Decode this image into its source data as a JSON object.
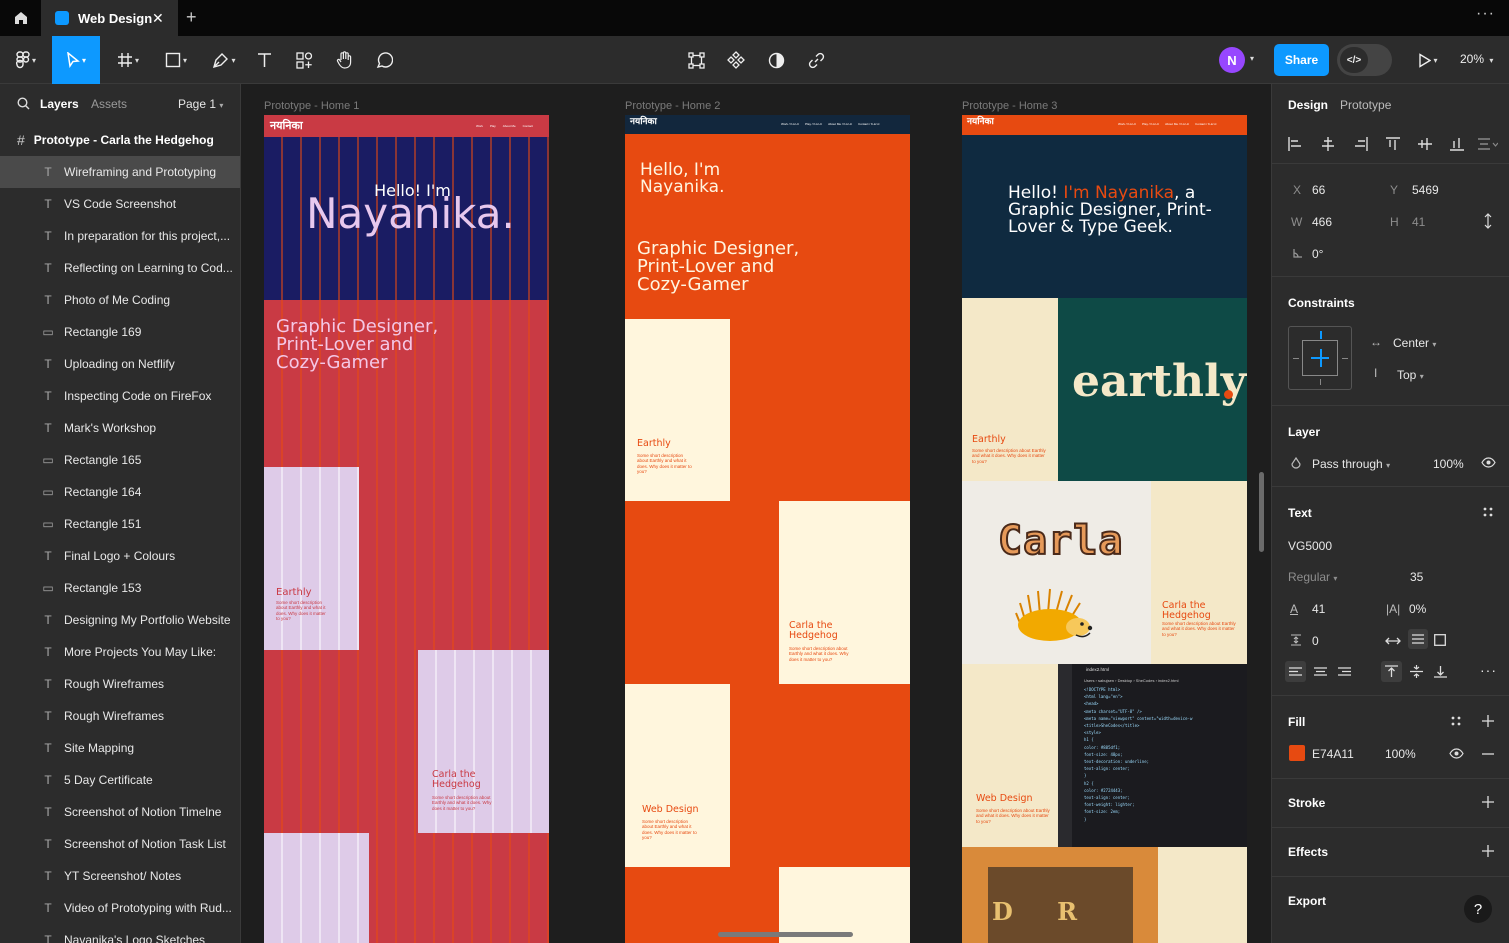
{
  "colors": {
    "accent": "#0d99ff",
    "fill": "#E74A11",
    "avatar": "#9747ff"
  },
  "titlebar": {
    "file_title": "Web Design",
    "close_glyph": "✕",
    "new_tab_glyph": "+",
    "more_glyph": "···",
    "home_icon": "home-icon"
  },
  "toolbar": {
    "avatar_initial": "N",
    "share_label": "Share",
    "dev_mode_glyph": "</>",
    "zoom": "20%"
  },
  "left": {
    "tab_layers": "Layers",
    "tab_assets": "Assets",
    "page": "Page 1",
    "root": "Prototype - Carla the Hedgehog",
    "layers": [
      {
        "name": "Wireframing and Prototyping",
        "type": "text"
      },
      {
        "name": "VS Code Screenshot",
        "type": "text"
      },
      {
        "name": "In preparation for this project,...",
        "type": "text"
      },
      {
        "name": "Reflecting on Learning to Cod...",
        "type": "text"
      },
      {
        "name": "Photo of Me Coding",
        "type": "text"
      },
      {
        "name": "Rectangle 169",
        "type": "rect"
      },
      {
        "name": "Uploading on Netflify",
        "type": "text"
      },
      {
        "name": "Inspecting Code on FireFox",
        "type": "text"
      },
      {
        "name": "Mark's Workshop",
        "type": "text"
      },
      {
        "name": "Rectangle 165",
        "type": "rect"
      },
      {
        "name": "Rectangle 164",
        "type": "rect"
      },
      {
        "name": "Rectangle 151",
        "type": "rect"
      },
      {
        "name": "Final Logo + Colours",
        "type": "text"
      },
      {
        "name": "Rectangle 153",
        "type": "rect"
      },
      {
        "name": "Designing My Portfolio Website",
        "type": "text"
      },
      {
        "name": "More Projects You May Like:",
        "type": "text"
      },
      {
        "name": "Rough Wireframes",
        "type": "text"
      },
      {
        "name": "Rough Wireframes",
        "type": "text"
      },
      {
        "name": "Site Mapping",
        "type": "text"
      },
      {
        "name": "5 Day Certificate",
        "type": "text"
      },
      {
        "name": "Screenshot of Notion Timelne",
        "type": "text"
      },
      {
        "name": "Screenshot of Notion Task List",
        "type": "text"
      },
      {
        "name": "YT Screenshot/ Notes",
        "type": "text"
      },
      {
        "name": "Video of Prototyping with Rud...",
        "type": "text"
      },
      {
        "name": "Navanika's Logo Sketches",
        "type": "text"
      }
    ]
  },
  "canvas": {
    "frame1": {
      "label": "Prototype - Home 1",
      "logo": "नयनिका",
      "nav": [
        "Work",
        "Play",
        "About Me",
        "Contact"
      ],
      "hello": "Hello! I'm",
      "name": "Nayanika.",
      "tagline": "Graphic Designer, Print-Lover and Cozy-Gamer",
      "card1_title": "Earthly",
      "card1_desc": "Some short description about Earthly and what it does. Why does it matter to you?",
      "card2_title": "Carla the Hedgehog",
      "card2_desc": "Some short description about Earthly and what it does. Why does it matter to you?"
    },
    "frame2": {
      "label": "Prototype - Home 2",
      "logo": "नयनिका",
      "nav": [
        "Work / K-k/-/c",
        "Play / K-k/-/c",
        "About Me / K-k/-/c",
        "Contact / K-k/-/c"
      ],
      "hello": "Hello, I'm Nayanika.",
      "tagline": "Graphic Designer, Print-Lover and Cozy-Gamer",
      "card1_title": "Earthly",
      "card1_desc": "Some short description about Earthly and what it does. Why does it matter to you?",
      "card2_title": "Carla the Hedgehog",
      "card2_desc": "Some short description about Earthly and what it does. Why does it matter to you?",
      "card3_title": "Web Design",
      "card3_desc": "Some short description about Earthly and what it does. Why does it matter to you?"
    },
    "frame3": {
      "label": "Prototype - Home 3",
      "logo": "नयनिका",
      "nav": [
        "Work / K-k/-/c",
        "Play / K-k/-/c",
        "About Me / K-k/-/c",
        "Contact / K-k/-/c"
      ],
      "hello_pre": "Hello! ",
      "hello_name": "I'm Nayanika",
      "hello_post": ", a Graphic Designer, Print-Lover & Type Geek.",
      "earthly_logo": "earthly",
      "card1_title": "Earthly",
      "card1_desc": "Some short description about Earthly and what it does. Why does it matter to you?",
      "carla_logo": "Carla",
      "card2_title": "Carla the Hedgehog",
      "card2_desc": "Some short description about Earthly and what it does. Why does it matter to you?",
      "card3_title": "Web Design",
      "card3_desc": "Some short description about Earthly and what it does. Why does it matter to you?",
      "code_tab": "index2.html",
      "code_path": "Users › sabujsen › Desktop › SheCodes › index2.html",
      "code_lines": [
        "<!DOCTYPE html>",
        "<html lang=\"en\">",
        "<head>",
        "<meta charset=\"UTF-8\" />",
        "<meta name=\"viewport\" content=\"width=device-w",
        "<title>SheCodes</title>",
        "",
        "<style>",
        "h1 {",
        "color: #885df1;",
        "font-size: 48px;",
        "text-decoration: underline;",
        "text-align: center;",
        "}",
        "",
        "h2 {",
        "color: #2724443;",
        "text-align: center;",
        "font-weight: lighter;",
        "font-size: 2em;",
        "}"
      ],
      "poster_letters": "D R"
    }
  },
  "right": {
    "tab_design": "Design",
    "tab_prototype": "Prototype",
    "x_label": "X",
    "x": "66",
    "y_label": "Y",
    "y": "5469",
    "w_label": "W",
    "w": "466",
    "h_label": "H",
    "h": "41",
    "rotation": "0°",
    "constraints_title": "Constraints",
    "constraint_h": "Center",
    "constraint_v": "Top",
    "layer_title": "Layer",
    "blend": "Pass through",
    "opacity": "100%",
    "text_title": "Text",
    "font": "VG5000",
    "weight": "Regular",
    "size": "35",
    "line_height": "41",
    "letter_spacing": "0%",
    "para_spacing": "0",
    "fill_title": "Fill",
    "fill_hex": "E74A11",
    "fill_opacity": "100%",
    "stroke_title": "Stroke",
    "effects_title": "Effects",
    "export_title": "Export",
    "help": "?"
  }
}
